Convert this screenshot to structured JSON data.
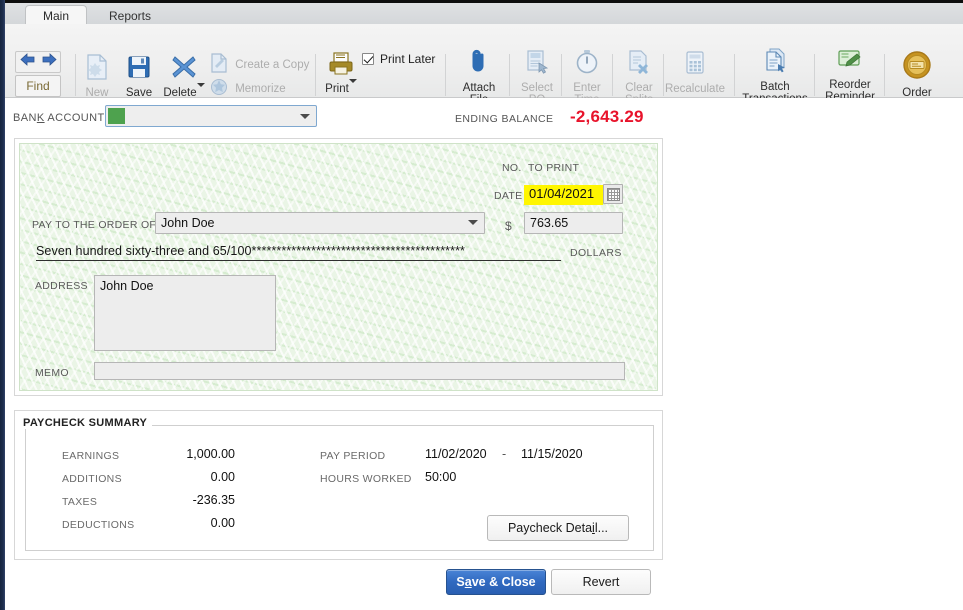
{
  "tabs": [
    {
      "label": "Main",
      "active": true
    },
    {
      "label": "Reports",
      "active": false
    }
  ],
  "toolbar": {
    "nav_back_icon": "arrow-left-icon",
    "nav_forward_icon": "arrow-right-icon",
    "find_label": "Find",
    "items": [
      {
        "label": "New",
        "icon": "new-document-icon",
        "disabled": true
      },
      {
        "label": "Save",
        "icon": "floppy-disk-icon",
        "disabled": false
      },
      {
        "label": "Delete",
        "icon": "x-cross-icon",
        "disabled": false,
        "has_dropdown": true
      },
      {
        "label": "Create a Copy",
        "icon": "copy-icon",
        "disabled": true
      },
      {
        "label": "Memorize",
        "icon": "memorize-star-icon",
        "disabled": true
      },
      {
        "label": "Print",
        "icon": "printer-icon",
        "disabled": false,
        "has_dropdown": true
      },
      {
        "label": "Attach\nFile",
        "icon": "paperclip-icon",
        "disabled": false
      },
      {
        "label": "Select\nPO",
        "icon": "select-po-icon",
        "disabled": true
      },
      {
        "label": "Enter\nTime",
        "icon": "stopwatch-icon",
        "disabled": true
      },
      {
        "label": "Clear\nSplits",
        "icon": "clear-splits-icon",
        "disabled": true
      },
      {
        "label": "Recalculate",
        "icon": "calculator-icon",
        "disabled": true
      },
      {
        "label": "Batch\nTransactions",
        "icon": "batch-transactions-icon",
        "disabled": false
      },
      {
        "label": "Reorder\nReminder",
        "icon": "reorder-reminder-icon",
        "disabled": false
      },
      {
        "label": "Order\nChecks",
        "icon": "order-checks-coin-icon",
        "disabled": false
      }
    ],
    "print_later": {
      "label": "Print Later",
      "checked": true
    }
  },
  "account_bar": {
    "label_pre": "BAN",
    "label_accel": "K",
    "label_post": " ACCOUNT",
    "value": "",
    "ending_balance_label": "ENDING BALANCE",
    "ending_balance_value": "-2,643.29",
    "ending_balance_color": "#e8132b"
  },
  "check": {
    "no_label": "NO.",
    "no_value": "TO PRINT",
    "date_label": "DATE",
    "date_value": "01/04/2021",
    "date_highlight_color": "#fff600",
    "payee_label": "PAY TO THE ORDER OF",
    "payee_value": "John Doe",
    "dollar_sign": "$",
    "amount_value": "763.65",
    "amount_words": "Seven hundred sixty-three and 65/100*******************************************",
    "dollars_label": "DOLLARS",
    "address_label": "ADDRESS",
    "address_value": "John Doe",
    "memo_label": "MEMO",
    "memo_value": ""
  },
  "summary": {
    "title": "PAYCHECK SUMMARY",
    "rows_left": [
      {
        "label": "EARNINGS",
        "value": "1,000.00"
      },
      {
        "label": "ADDITIONS",
        "value": "0.00"
      },
      {
        "label": "TAXES",
        "value": "-236.35"
      },
      {
        "label": "DEDUCTIONS",
        "value": "0.00"
      }
    ],
    "rows_right": [
      {
        "label": "PAY PERIOD",
        "value": "11/02/2020",
        "sep": "-",
        "value2": "11/15/2020"
      },
      {
        "label": "HOURS WORKED",
        "value": "50:00",
        "sep": "",
        "value2": ""
      }
    ],
    "detail_button_pre": "Paycheck Deta",
    "detail_button_accel": "i",
    "detail_button_post": "l..."
  },
  "footer": {
    "save_pre": "S",
    "save_accel": "a",
    "save_post": "ve & Close",
    "revert_label": "Revert"
  }
}
